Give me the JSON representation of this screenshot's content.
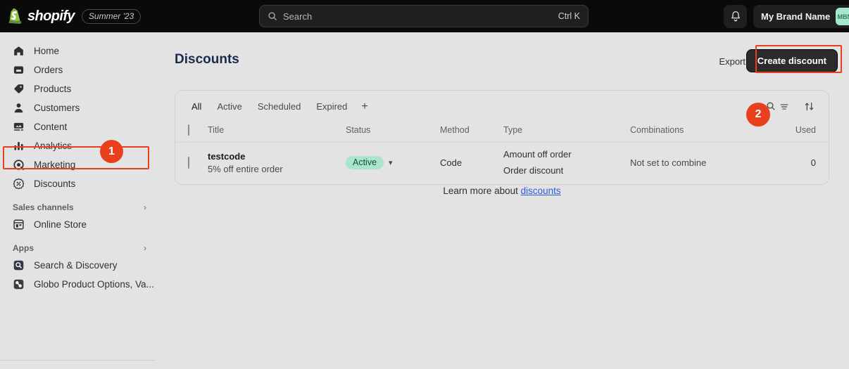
{
  "topbar": {
    "logo_text": "shopify",
    "logo_icon": "shopify-bag-icon",
    "season_badge": "Summer '23",
    "search": {
      "placeholder": "Search",
      "shortcut": "Ctrl K",
      "icon": "search-icon"
    },
    "notifications_icon": "bell-icon",
    "user": {
      "name": "My Brand Name",
      "initials": "MBN",
      "avatar_color": "#a4e8cd"
    }
  },
  "sidebar": {
    "items": [
      {
        "label": "Home",
        "icon": "home-icon"
      },
      {
        "label": "Orders",
        "icon": "orders-inbox-icon"
      },
      {
        "label": "Products",
        "icon": "products-tag-icon"
      },
      {
        "label": "Customers",
        "icon": "customers-person-icon"
      },
      {
        "label": "Content",
        "icon": "content-icon"
      },
      {
        "label": "Analytics",
        "icon": "analytics-bars-icon"
      },
      {
        "label": "Marketing",
        "icon": "marketing-target-icon"
      },
      {
        "label": "Discounts",
        "icon": "discounts-percent-icon"
      }
    ],
    "sales_channels": {
      "label": "Sales channels",
      "chevron": "›"
    },
    "sales_channel_items": [
      {
        "label": "Online Store",
        "icon": "online-store-icon"
      }
    ],
    "apps": {
      "label": "Apps",
      "chevron": "›"
    },
    "app_items": [
      {
        "label": "Search & Discovery",
        "icon": "search-discovery-app-icon"
      },
      {
        "label": "Globo Product Options, Va...",
        "icon": "globo-app-icon"
      }
    ]
  },
  "annotations": {
    "accent_color": "#e8401c",
    "step_one": "1",
    "step_two": "2"
  },
  "main": {
    "page_title": "Discounts",
    "export_label": "Export",
    "create_button": "Create discount",
    "tabs": [
      {
        "label": "All",
        "active": true
      },
      {
        "label": "Active",
        "active": false
      },
      {
        "label": "Scheduled",
        "active": false
      },
      {
        "label": "Expired",
        "active": false
      }
    ],
    "tab_add": "+",
    "tools": [
      {
        "name": "search-and-filter-button",
        "icon": "search-filter-icon"
      },
      {
        "name": "sort-button",
        "icon": "sort-arrows-icon"
      }
    ],
    "table": {
      "headers": {
        "title": "Title",
        "status": "Status",
        "method": "Method",
        "type": "Type",
        "combinations": "Combinations",
        "used": "Used"
      },
      "rows": [
        {
          "title": "testcode",
          "subtitle": "5% off entire order",
          "status": "Active",
          "status_color": "#a9e4cd",
          "method": "Code",
          "type_line1": "Amount off order",
          "type_line2": "Order discount",
          "combinations": "Not set to combine",
          "used": "0"
        }
      ]
    },
    "footer": {
      "text": "Learn more about ",
      "link": "discounts"
    }
  }
}
